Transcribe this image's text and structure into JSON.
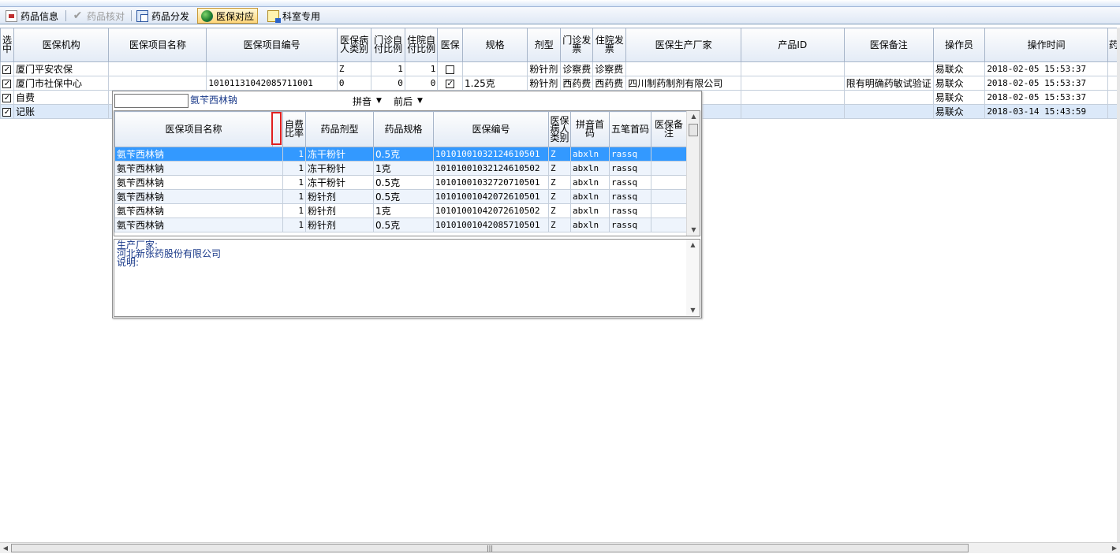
{
  "tabs": [
    {
      "label": "药品信息",
      "icon": "drug-info-icon",
      "state": "normal"
    },
    {
      "label": "药品核对",
      "icon": "checkmark-icon",
      "state": "disabled"
    },
    {
      "label": "药品分发",
      "icon": "distribute-icon",
      "state": "normal"
    },
    {
      "label": "医保对应",
      "icon": "globe-icon",
      "state": "active"
    },
    {
      "label": "科室专用",
      "icon": "department-icon",
      "state": "normal"
    }
  ],
  "main_grid": {
    "headers": [
      "选中",
      "医保机构",
      "医保项目名称",
      "医保项目编号",
      "医保病人类别",
      "门诊自付比例",
      "住院自付比例",
      "医保",
      "规格",
      "剂型",
      "门诊发票",
      "住院发票",
      "医保生产厂家",
      "产品ID",
      "医保备注",
      "操作员",
      "操作时间",
      "药"
    ],
    "rows": [
      {
        "checked": true,
        "org": "厦门平安农保",
        "name": "",
        "code": "",
        "category": "Z",
        "opd_ratio": "1",
        "ipd_ratio": "1",
        "insured": false,
        "spec": "",
        "form": "粉针剂",
        "opd_invoice": "诊察费",
        "ipd_invoice": "诊察费",
        "maker": "",
        "product_id": "",
        "remark": "",
        "operator": "易联众",
        "time": "2018-02-05 15:53:37"
      },
      {
        "checked": true,
        "org": "厦门市社保中心",
        "name": "",
        "code": "10101131042085711001",
        "category": "0",
        "opd_ratio": "0",
        "ipd_ratio": "0",
        "insured": true,
        "spec": "1.25克",
        "form": "粉针剂",
        "opd_invoice": "西药费",
        "ipd_invoice": "西药费",
        "maker": "四川制药制剂有限公司",
        "product_id": "",
        "remark": "限有明确药敏试验证",
        "operator": "易联众",
        "time": "2018-02-05 15:53:37"
      },
      {
        "checked": true,
        "org": "自费",
        "name": "",
        "code": "",
        "category": "",
        "opd_ratio": "",
        "ipd_ratio": "",
        "insured": null,
        "spec": "",
        "form": "",
        "opd_invoice": "",
        "ipd_invoice": "",
        "maker": "",
        "product_id": "",
        "remark": "",
        "operator": "易联众",
        "time": "2018-02-05 15:53:37"
      },
      {
        "checked": true,
        "org": "记账",
        "name": "",
        "code": "",
        "category": "",
        "opd_ratio": "",
        "ipd_ratio": "",
        "insured": null,
        "spec": "",
        "form": "",
        "opd_invoice": "",
        "ipd_invoice": "",
        "maker": "",
        "product_id": "",
        "remark": "",
        "operator": "易联众",
        "time": "2018-03-14 15:43:59"
      }
    ]
  },
  "popup": {
    "search_value": "",
    "search_text": "氨苄西林钠",
    "dropdown_pinyin": "拼音",
    "dropdown_order": "前后",
    "headers": [
      "医保项目名称",
      "",
      "自费比率",
      "药品剂型",
      "药品规格",
      "医保编号",
      "医保病人类别",
      "拼音首码",
      "五笔首码",
      "医保备注"
    ],
    "rows": [
      {
        "name": "氨苄西林钠",
        "ratio": "1",
        "form": "冻干粉针",
        "spec": "0.5克",
        "code": "10101001032124610501",
        "category": "Z",
        "pinyin": "abxln",
        "wubi": "rassq",
        "remark": ""
      },
      {
        "name": "氨苄西林钠",
        "ratio": "1",
        "form": "冻干粉针",
        "spec": "1克",
        "code": "10101001032124610502",
        "category": "Z",
        "pinyin": "abxln",
        "wubi": "rassq",
        "remark": ""
      },
      {
        "name": "氨苄西林钠",
        "ratio": "1",
        "form": "冻干粉针",
        "spec": "0.5克",
        "code": "10101001032720710501",
        "category": "Z",
        "pinyin": "abxln",
        "wubi": "rassq",
        "remark": ""
      },
      {
        "name": "氨苄西林钠",
        "ratio": "1",
        "form": "粉针剂",
        "spec": "0.5克",
        "code": "10101001042072610501",
        "category": "Z",
        "pinyin": "abxln",
        "wubi": "rassq",
        "remark": ""
      },
      {
        "name": "氨苄西林钠",
        "ratio": "1",
        "form": "粉针剂",
        "spec": "1克",
        "code": "10101001042072610502",
        "category": "Z",
        "pinyin": "abxln",
        "wubi": "rassq",
        "remark": ""
      },
      {
        "name": "氨苄西林钠",
        "ratio": "1",
        "form": "粉针剂",
        "spec": "0.5克",
        "code": "10101001042085710501",
        "category": "Z",
        "pinyin": "abxln",
        "wubi": "rassq",
        "remark": ""
      }
    ],
    "detail": {
      "maker_label": "生产厂家:",
      "maker_value": "河北新张药股份有限公司",
      "note_label": "说明:"
    }
  },
  "colors": {
    "highlight_row": "#3399ff",
    "active_tab": "#ffd67a",
    "popup_text": "#1a3a8a"
  }
}
